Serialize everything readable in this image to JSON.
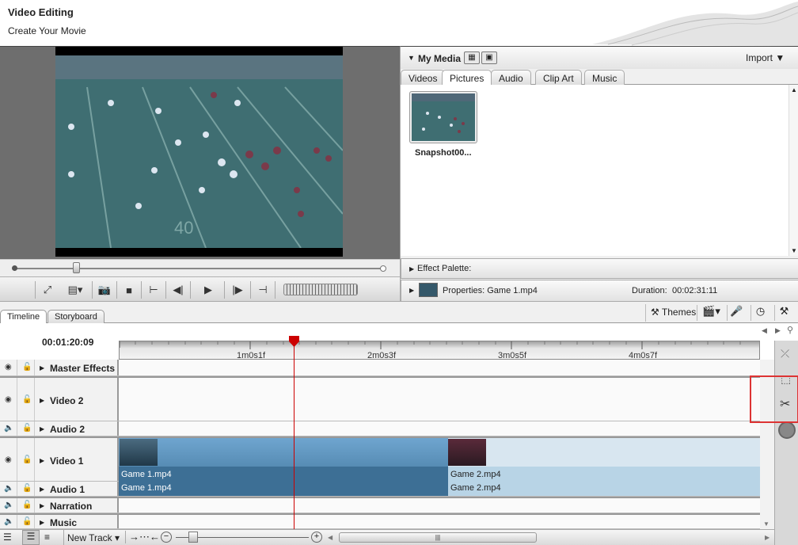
{
  "header": {
    "title": "Video Editing",
    "subtitle": "Create Your Movie"
  },
  "media": {
    "title": "My Media",
    "import_label": "Import",
    "tabs": [
      "Videos",
      "Pictures",
      "Audio",
      "Clip Art",
      "Music"
    ],
    "active_tab": "Pictures",
    "items": [
      {
        "label": "Snapshot00..."
      }
    ]
  },
  "effect_palette": {
    "label": "Effect Palette:"
  },
  "properties": {
    "label": "Properties: Game 1.mp4",
    "duration_label": "Duration:",
    "duration_value": "00:02:31:11"
  },
  "timeline": {
    "tabs": [
      "Timeline",
      "Storyboard"
    ],
    "active_tab": "Timeline",
    "themes_label": "Themes",
    "timecode": "00:01:20:09",
    "ruler_labels": [
      "1m0s1f",
      "2m0s3f",
      "3m0s5f",
      "4m0s7f"
    ],
    "tracks": [
      {
        "name": "Master Effects"
      },
      {
        "name": "Video 2"
      },
      {
        "name": "Audio 2"
      },
      {
        "name": "Video 1"
      },
      {
        "name": "Audio 1"
      },
      {
        "name": "Narration"
      },
      {
        "name": "Music"
      }
    ],
    "clips": {
      "video1": [
        "Game 1.mp4",
        "Game 2.mp4"
      ],
      "audio1": [
        "Game 1.mp4",
        "Game 2.mp4"
      ]
    },
    "new_track_label": "New Track"
  },
  "colors": {
    "clip_selected": "#4a7fa6",
    "clip_normal": "#b8d4e6",
    "playhead": "#cc0000",
    "highlight": "#dd3333"
  }
}
